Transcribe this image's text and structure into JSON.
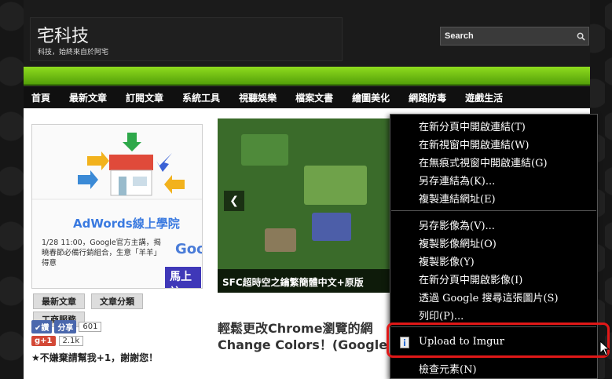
{
  "header": {
    "site_title": "宅科技",
    "tagline": "科技，始終來自於阿宅",
    "search_placeholder": "Search"
  },
  "nav": {
    "items": [
      "首頁",
      "最新文章",
      "訂閱文章",
      "系統工具",
      "視聽娛樂",
      "檔案文書",
      "繪圖美化",
      "網路防毒",
      "遊戲生活"
    ]
  },
  "ad": {
    "title": "AdWords線上學院",
    "text": "1/28 11:00，Google官方主講，揭曉春節必備行銷組合，生意「羊羊」得意",
    "logo": "Goo",
    "cta": "馬上註"
  },
  "sidebar": {
    "tabs": [
      "最新文章",
      "文章分類",
      "工商服務"
    ],
    "like_label": "讚",
    "share_label": "分享",
    "share_count": "601",
    "gplus_label": "g+1",
    "gplus_count": "2.1k",
    "slogan": "★不嫌棄請幫我+1，謝謝您！"
  },
  "slider": {
    "caption": "SFC超時空之鑰繁簡體中文+原版"
  },
  "post": {
    "title_line1": "輕鬆更改Chrome瀏覽的網",
    "title_line2": "Change Colors！(Google"
  },
  "context_menu": {
    "group1": [
      "在新分頁中開啟連結(T)",
      "在新視窗中開啟連結(W)",
      "在無痕式視窗中開啟連結(G)",
      "另存連結為(K)...",
      "複製連結網址(E)"
    ],
    "group2": [
      "另存影像為(V)...",
      "複製影像網址(O)",
      "複製影像(Y)",
      "在新分頁中開啟影像(I)",
      "透過 Google 搜尋這張圖片(S)",
      "列印(P)..."
    ],
    "upload": "Upload to Imgur",
    "inspect": "檢查元素(N)"
  },
  "colors": {
    "accent_green": "#8fdc1e",
    "highlight_red": "#e01818",
    "menu_bg": "#000000"
  }
}
